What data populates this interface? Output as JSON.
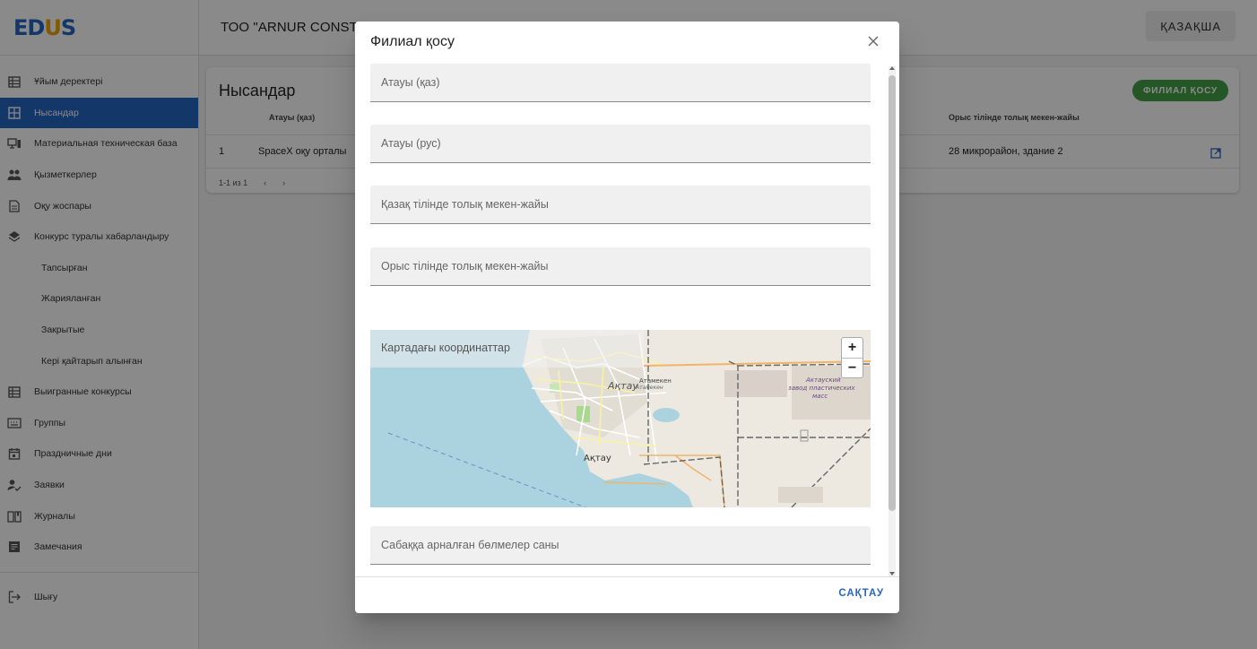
{
  "header": {
    "logo_part1": "ED",
    "logo_part2": "U",
    "logo_part3": "S",
    "org_title": "ТОО \"ARNUR CONSTR",
    "lang_button": "ҚАЗАҚША"
  },
  "sidebar": {
    "items": [
      {
        "label": "Ұйым деректері",
        "icon": "building-icon"
      },
      {
        "label": "Нысандар",
        "icon": "grid-icon",
        "active": true
      },
      {
        "label": "Материальная техническая база",
        "icon": "devices-icon"
      },
      {
        "label": "Қызметкерлер",
        "icon": "people-icon"
      },
      {
        "label": "Оқу жоспары",
        "icon": "document-icon"
      },
      {
        "label": "Конкурс туралы хабарландыру",
        "icon": "layers-icon"
      },
      {
        "label": "Тапсырған",
        "sub": true
      },
      {
        "label": "Жарияланған",
        "sub": true
      },
      {
        "label": "Закрытые",
        "sub": true
      },
      {
        "label": "Кері қайтарып алынған",
        "sub": true
      },
      {
        "label": "Выигранные конкурсы",
        "icon": "building-icon"
      },
      {
        "label": "Группы",
        "icon": "keyboard-icon"
      },
      {
        "label": "Праздничные дни",
        "icon": "calendar-icon"
      },
      {
        "label": "Заявки",
        "icon": "person-check-icon"
      },
      {
        "label": "Журналы",
        "icon": "book-icon"
      },
      {
        "label": "Замечания",
        "icon": "notes-icon"
      }
    ],
    "logout_label": "Шығу"
  },
  "content": {
    "card_title": "Нысандар",
    "add_button": "ФИЛИАЛ ҚОСУ",
    "columns": [
      "Атауы (қаз)",
      "Орыс тілінде толық мекен-жайы"
    ],
    "rows": [
      {
        "num": "1",
        "name": "SpaceX оқу орталы",
        "address_ru": "28 микрорайон, здание 2"
      }
    ],
    "pager_text": "1-1 из 1",
    "pager_prev": "‹",
    "pager_next": "›"
  },
  "dialog": {
    "title": "Филиал қосу",
    "close_symbol": "×",
    "fields": [
      {
        "label": "Атауы (қаз)"
      },
      {
        "label": "Атауы (рус)"
      },
      {
        "label": "Қазақ тілінде толық мекен-жайы"
      },
      {
        "label": "Орыс тілінде толық мекен-жайы"
      }
    ],
    "map": {
      "label": "Картадағы координаттар",
      "zoom_in": "+",
      "zoom_out": "−",
      "places": [
        "Ақтау",
        "Ақтау",
        "Атамекен",
        "Атамекен",
        "Актауский",
        "завод пластических",
        "масс"
      ]
    },
    "field_after_map": "Сабаққа арналған бөлмелер саны",
    "save_button": "САҚТАУ"
  },
  "colors": {
    "primary": "#2566c4",
    "logo_accent": "#f0a400",
    "success": "#43a047"
  }
}
